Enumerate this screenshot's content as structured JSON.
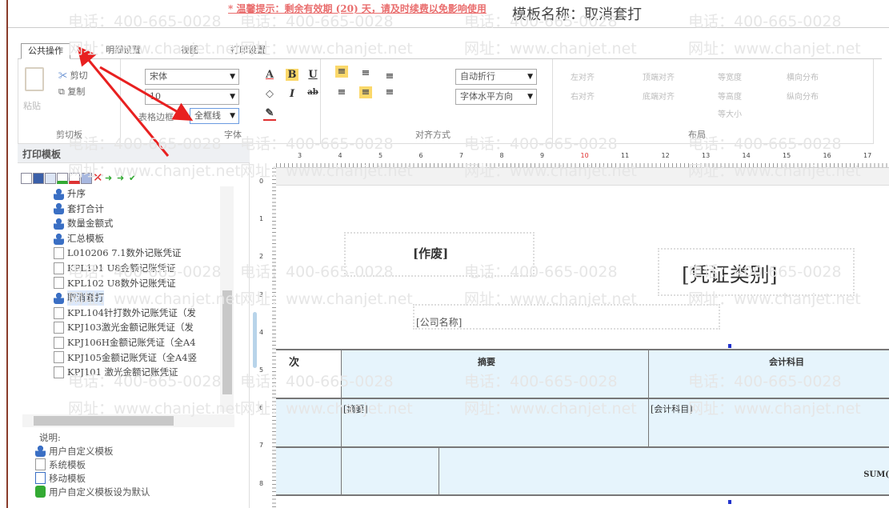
{
  "notice": "* 温馨提示：剩余有效期 (20) 天，请及时续费以免影响使用",
  "template_title": "模板名称：取消套打",
  "watermark": {
    "phone": "电话：400-665-0028",
    "site": "网址：www.chanjet.net"
  },
  "tabs": [
    {
      "label": "公共操作",
      "active": true
    },
    {
      "label": "明细设置"
    },
    {
      "label": "视图"
    },
    {
      "label": "打印设置"
    }
  ],
  "ribbon": {
    "clipboard": {
      "label": "剪切板",
      "paste": "粘贴",
      "cut": "剪切",
      "copy": "复制"
    },
    "font": {
      "label": "字体",
      "family": "宋体",
      "size": "10",
      "border_label": "表格边框",
      "border_value": "全框线"
    },
    "align": {
      "label": "对齐方式",
      "wrap": "自动折行",
      "direction": "字体水平方向"
    },
    "layout": {
      "label": "布局",
      "items": [
        "左对齐",
        "顶端对齐",
        "等宽度",
        "横向分布",
        "右对齐",
        "底端对齐",
        "等高度",
        "纵向分布",
        "等大小"
      ]
    }
  },
  "panel": {
    "title": "打印模板",
    "items": [
      {
        "label": "升序",
        "type": "user"
      },
      {
        "label": "套打合计",
        "type": "user"
      },
      {
        "label": "数量金额式",
        "type": "user"
      },
      {
        "label": "汇总模板",
        "type": "user"
      },
      {
        "label": "L010206 7.1数外记账凭证",
        "type": "system"
      },
      {
        "label": "KPL101 U8金额记账凭证",
        "type": "system"
      },
      {
        "label": "KPL102 U8数外记账凭证",
        "type": "system"
      },
      {
        "label": "取消套打",
        "type": "user",
        "selected": true
      },
      {
        "label": "KPL104针打数外记账凭证（发",
        "type": "system"
      },
      {
        "label": "KPJ103激光金额记账凭证（发",
        "type": "system"
      },
      {
        "label": "KPJ106H金额记账凭证（全A4",
        "type": "system"
      },
      {
        "label": "KPJ105金额记账凭证（全A4竖",
        "type": "system"
      },
      {
        "label": "KPJ101 激光金额记账凭证",
        "type": "system"
      }
    ],
    "legend_title": "说明:",
    "legend": [
      "用户自定义模板",
      "系统模板",
      "移动模板",
      "用户自定义模板设为默认"
    ]
  },
  "ruler": {
    "top": [
      "3",
      "4",
      "5",
      "6",
      "7",
      "8",
      "9",
      "10",
      "11",
      "12",
      "13",
      "14",
      "15",
      "16",
      "17"
    ],
    "left": [
      "0",
      "1",
      "2",
      "3",
      "4",
      "5",
      "6",
      "7",
      "8"
    ],
    "highlight": "10"
  },
  "canvas": {
    "void": "[作废]",
    "voucher_type": "[凭证类别]",
    "company": "[公司名称]",
    "table": {
      "col_seq": "次",
      "col_summary": "摘要",
      "col_account": "会计科目",
      "summary_field": "[摘要]",
      "account_field": "[会计科目]",
      "sum": "SUM("
    }
  },
  "colors": {
    "accent_red": "#e03030",
    "cell_bg": "#e6f4fc"
  }
}
